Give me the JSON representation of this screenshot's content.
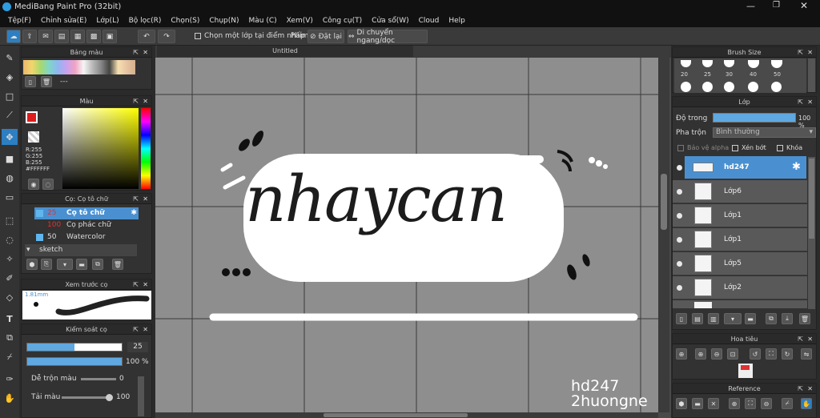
{
  "title": "MediBang Paint Pro (32bit)",
  "menu": [
    "Tệp(F)",
    "Chỉnh sửa(E)",
    "Lớp(L)",
    "Bộ lọc(R)",
    "Chọn(S)",
    "Chụp(N)",
    "Màu (C)",
    "Xem(V)",
    "Công cụ(T)",
    "Cửa sổ(W)",
    "Cloud",
    "Help"
  ],
  "toolbar": {
    "select_one_layer": "Chọn một lớp tại điểm nhấp",
    "phim_label": "Phím",
    "dat_lai": "Đặt lại",
    "di_chuyen": "Di chuyển ngang/dọc"
  },
  "palette": {
    "title": "Bảng màu",
    "value": "---"
  },
  "color": {
    "title": "Màu",
    "r": "R:255",
    "g": "G:255",
    "b": "B:255",
    "hex": "#FFFFFF"
  },
  "brush": {
    "title": "Cọ: Cọ tô chữ",
    "items": [
      {
        "size": "25",
        "name": "Cọ tô chữ",
        "swatch": "#5fb6ec"
      },
      {
        "size": "100",
        "name": "Cọ phác chữ",
        "swatch": "#333333"
      },
      {
        "size": "50",
        "name": "Watercolor",
        "swatch": "#5fb6ec"
      }
    ],
    "group": "sketch"
  },
  "preview": {
    "title": "Xem trước cọ",
    "size": "1.81mm"
  },
  "brush_control": {
    "title": "Kiểm soát cọ",
    "size_value": "25",
    "opacity_value": "100 %",
    "blend_label": "Dễ trộn màu",
    "blend_value": "0",
    "load_label": "Tải màu",
    "load_value": "100"
  },
  "tab": {
    "title": "Untitled"
  },
  "brush_size": {
    "title": "Brush Size",
    "sizes": [
      "20",
      "25",
      "30",
      "40",
      "50"
    ]
  },
  "layers": {
    "title": "Lớp",
    "opacity_label": "Độ trong",
    "opacity_value": "100 %",
    "blend_label": "Pha trộn",
    "blend_value": "Bình thường",
    "protect_alpha": "Bảo vệ alpha",
    "clip": "Xén bớt",
    "lock": "Khóa",
    "items": [
      "hd247",
      "Lớp6",
      "Lớp1",
      "Lớp1",
      "Lớp5",
      "Lớp2"
    ]
  },
  "navigator": {
    "title": "Hoa tiêu"
  },
  "reference": {
    "title": "Reference"
  },
  "canvas": {
    "art_text": "nhaycan",
    "watermark_line1": "hd247",
    "watermark_line2": "2huongne"
  }
}
